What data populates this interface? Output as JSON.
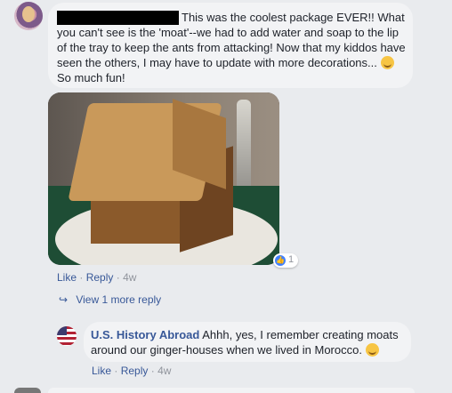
{
  "comment": {
    "text": "This was the coolest package EVER!! What you can't see is the 'moat'--we had to add water and soap to the lip of the tray to keep the ants from attacking! Now that my kiddos have seen the others, I may have to update with more decorations...",
    "text_tail": "So much fun!",
    "reaction_count": "1",
    "like_label": "Like",
    "reply_label": "Reply",
    "time": "4w",
    "sep": "·"
  },
  "view_more": "View 1 more reply",
  "reply": {
    "author": "U.S. History Abroad",
    "text": "Ahhh, yes, I remember creating moats around our ginger-houses when we lived in Morocco.",
    "like_label": "Like",
    "reply_label": "Reply",
    "time": "4w",
    "sep": "·"
  },
  "icons": {
    "reaction": "like-icon",
    "view_more": "reply-arrow-icon",
    "emoji": "smiley-emoji-icon"
  },
  "colors": {
    "link": "#385898",
    "bubble": "#f2f3f5",
    "background": "#e9ebee",
    "like_blue": "#4080ff"
  }
}
